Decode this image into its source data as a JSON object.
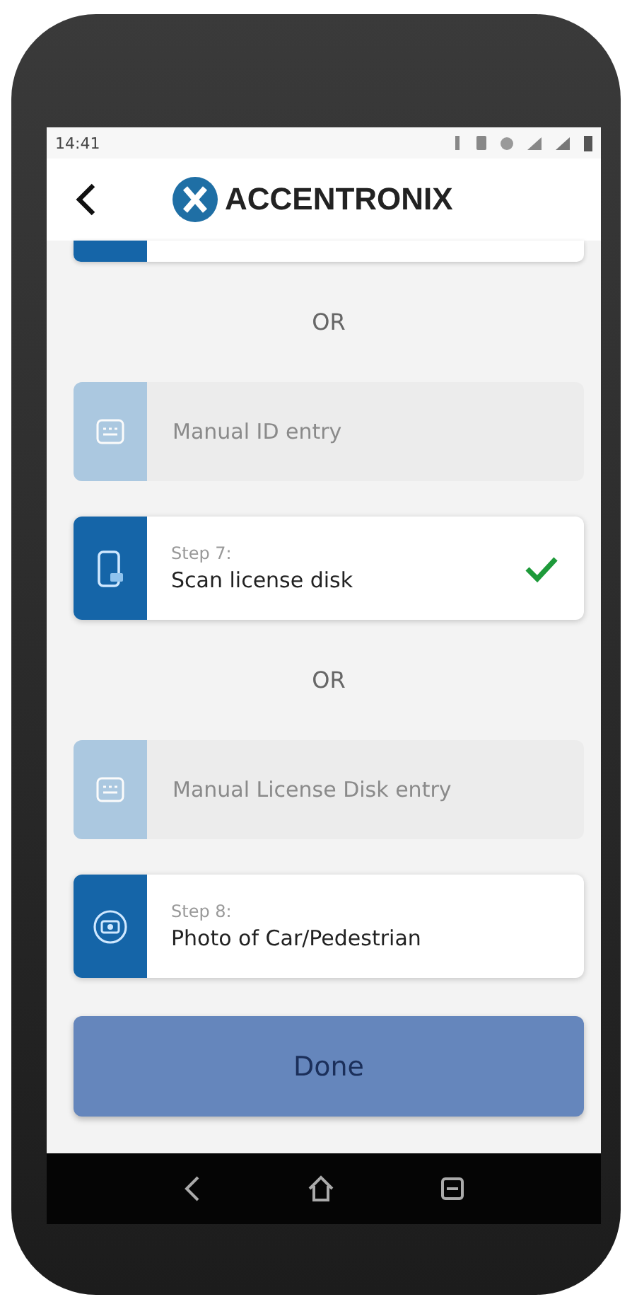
{
  "status_bar": {
    "time": "14:41"
  },
  "header": {
    "logo_text": "ACCENTRONIX"
  },
  "items": [
    {
      "kind": "partial"
    },
    {
      "kind": "divider",
      "text": "OR"
    },
    {
      "kind": "option",
      "label": "Manual ID entry",
      "disabled": true
    },
    {
      "kind": "step",
      "step": "Step 7:",
      "title": "Scan license disk",
      "done": true
    },
    {
      "kind": "divider",
      "text": "OR"
    },
    {
      "kind": "option",
      "label": "Manual License Disk entry",
      "disabled": true
    },
    {
      "kind": "step",
      "step": "Step 8:",
      "title": "Photo of Car/Pedestrian",
      "done": false
    }
  ],
  "done_button": {
    "label": "Done"
  }
}
